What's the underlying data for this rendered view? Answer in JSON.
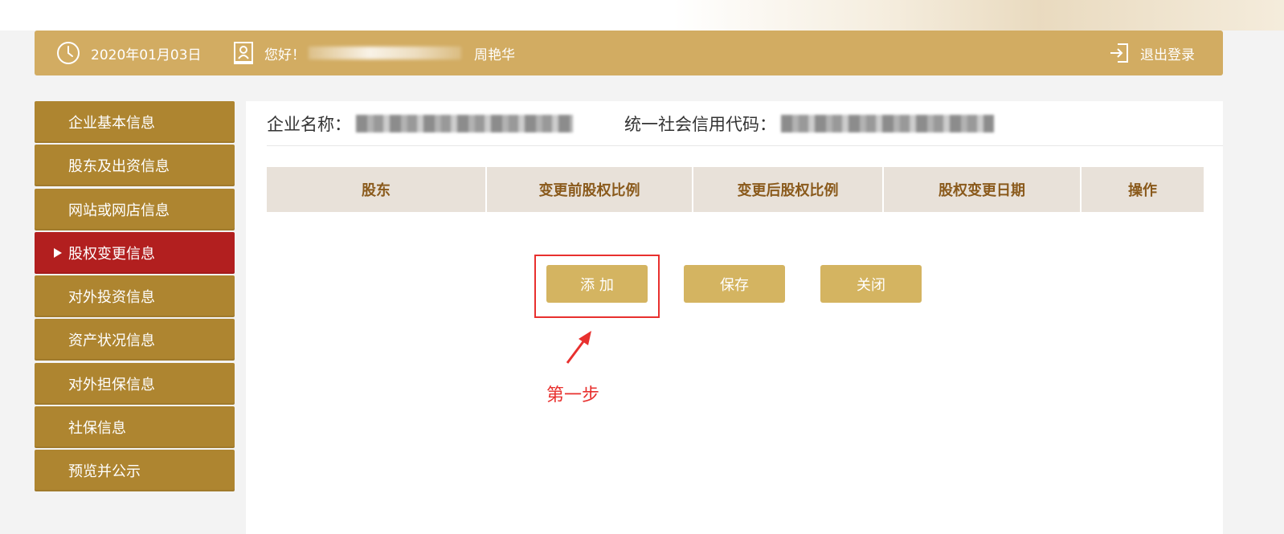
{
  "header": {
    "date": "2020年01月03日",
    "greeting": "您好！",
    "user_name": "周艳华",
    "logout_label": "退出登录"
  },
  "sidebar": {
    "items": [
      {
        "label": "企业基本信息",
        "active": false
      },
      {
        "label": "股东及出资信息",
        "active": false
      },
      {
        "label": "网站或网店信息",
        "active": false
      },
      {
        "label": "股权变更信息",
        "active": true
      },
      {
        "label": "对外投资信息",
        "active": false
      },
      {
        "label": "资产状况信息",
        "active": false
      },
      {
        "label": "对外担保信息",
        "active": false
      },
      {
        "label": "社保信息",
        "active": false
      },
      {
        "label": "预览并公示",
        "active": false
      }
    ]
  },
  "company": {
    "name_label": "企业名称：",
    "credit_code_label": "统一社会信用代码："
  },
  "table": {
    "columns": [
      "股东",
      "变更前股权比例",
      "变更后股权比例",
      "股权变更日期",
      "操作"
    ]
  },
  "buttons": {
    "add": "添 加",
    "save": "保存",
    "close": "关闭"
  },
  "annotation": {
    "step_label": "第一步"
  },
  "colors": {
    "header_bg": "#d2ac62",
    "sidebar_bg": "#ae8530",
    "sidebar_active_bg": "#b21f1f",
    "button_bg": "#d4b461",
    "table_header_bg": "#e8e1d9",
    "table_header_text": "#8a5a1c",
    "annotation_red": "#e8302e"
  }
}
